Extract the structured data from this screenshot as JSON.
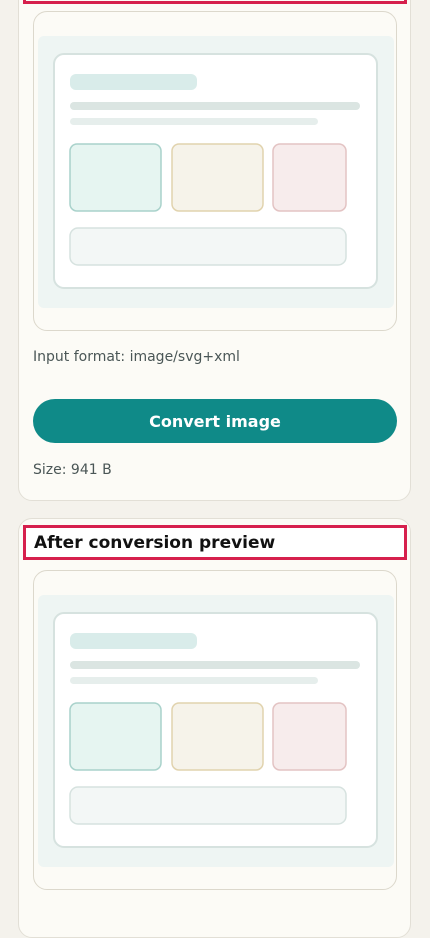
{
  "converter": {
    "input_format": "Input format: image/svg+xml",
    "convert_label": "Convert image",
    "size": "Size: 941 B"
  },
  "result": {
    "heading": "After conversion preview"
  },
  "colors": {
    "accent": "#0f8a88",
    "highlight": "#d6204d",
    "teal_tile": "#e6f5f1",
    "sand_tile": "#f6f3ea",
    "pink_tile": "#f7ecec"
  }
}
